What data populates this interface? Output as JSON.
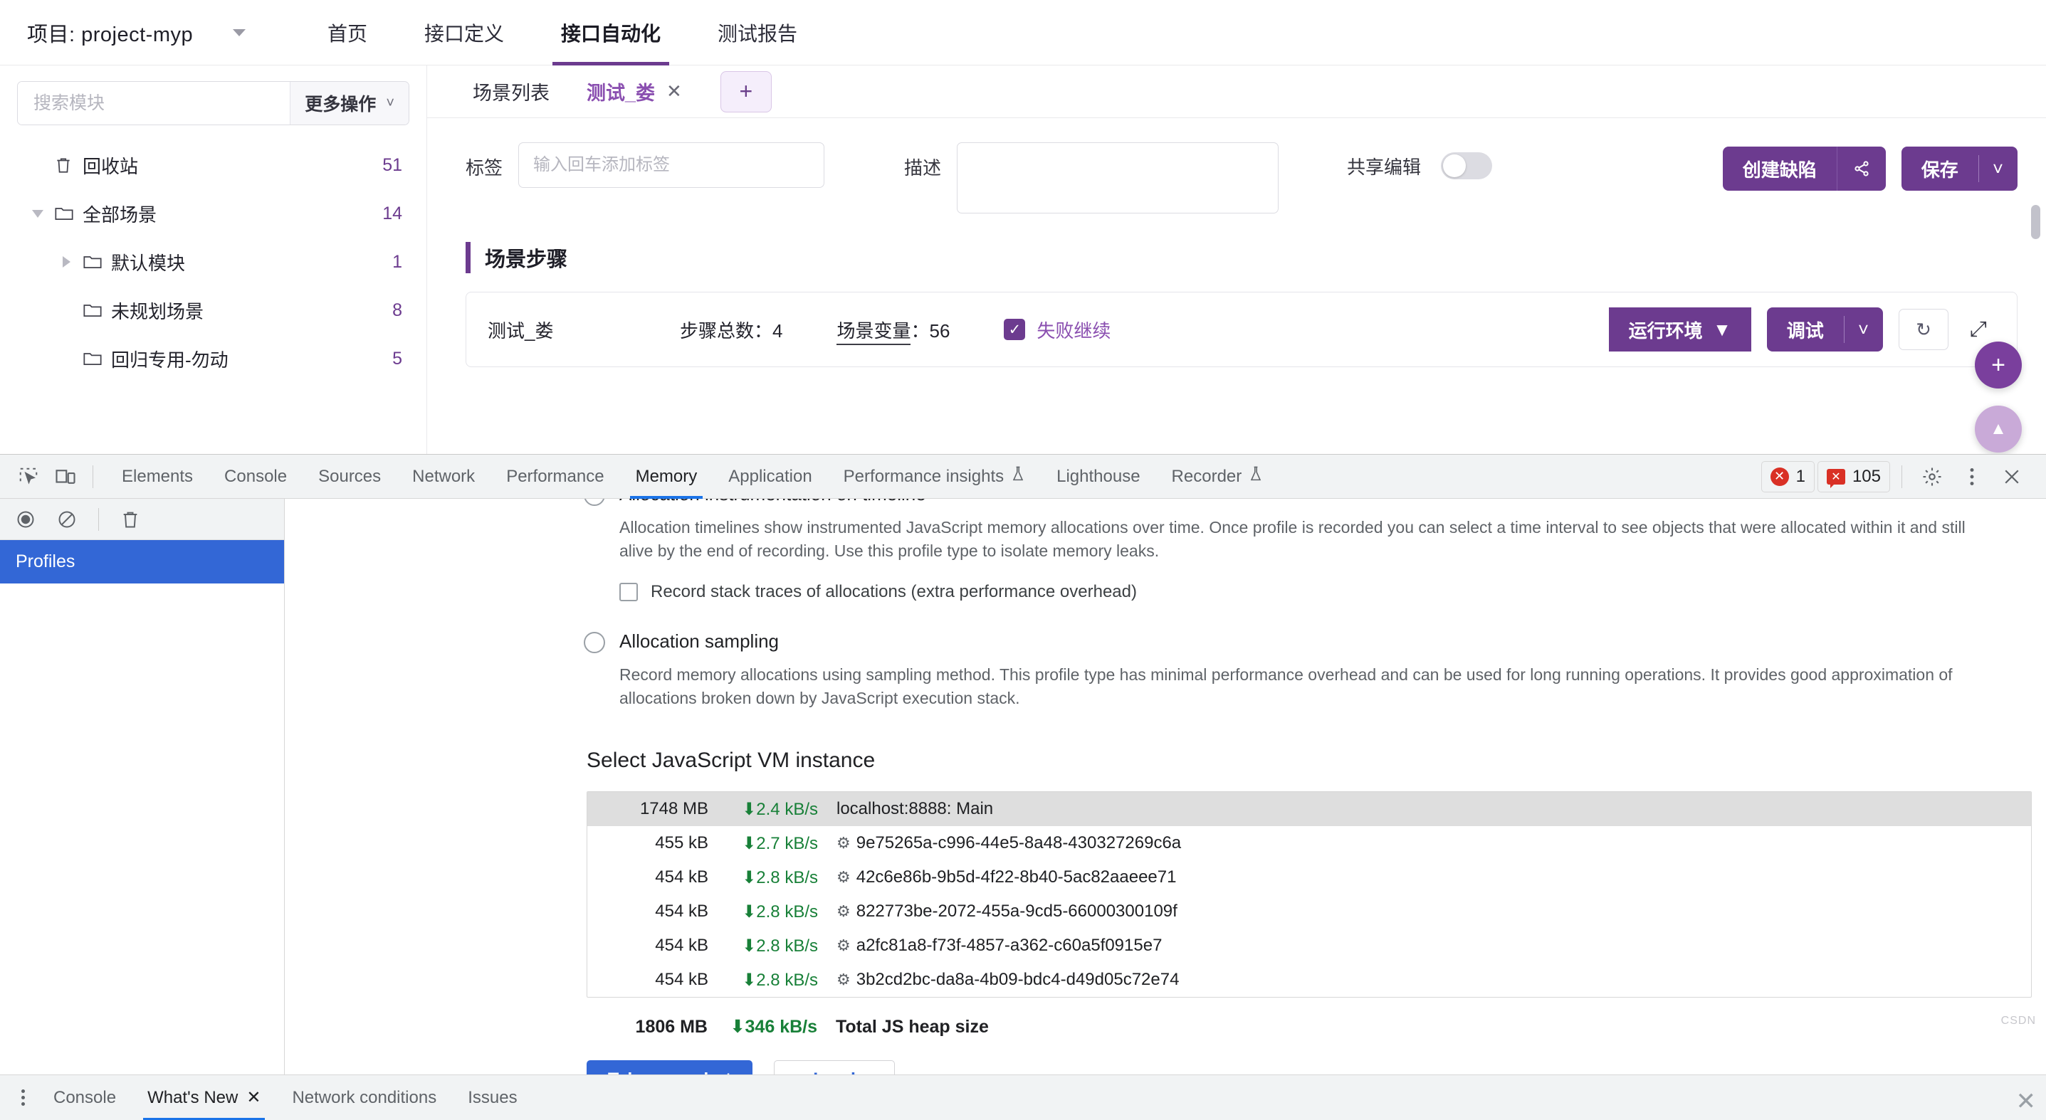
{
  "webapp": {
    "project": {
      "label": "项目: project-myp",
      "caret": "chevron-down-icon"
    },
    "nav_tabs": [
      {
        "label": "首页",
        "active": false
      },
      {
        "label": "接口定义",
        "active": false
      },
      {
        "label": "接口自动化",
        "active": true
      },
      {
        "label": "测试报告",
        "active": false
      }
    ],
    "sidebar": {
      "search_placeholder": "搜索模块",
      "search_value": "",
      "more_ops_label": "更多操作",
      "tree": [
        {
          "label": "回收站",
          "count": "51",
          "icon": "trash-icon",
          "level": 0,
          "arrow": "none"
        },
        {
          "label": "全部场景",
          "count": "14",
          "icon": "folder-icon",
          "level": 1,
          "arrow": "down"
        },
        {
          "label": "默认模块",
          "count": "1",
          "icon": "folder-icon",
          "level": 2,
          "arrow": "right"
        },
        {
          "label": "未规划场景",
          "count": "8",
          "icon": "folder-icon",
          "level": 2,
          "arrow": "none"
        },
        {
          "label": "回归专用-勿动",
          "count": "5",
          "icon": "folder-icon",
          "level": 2,
          "arrow": "none"
        }
      ]
    },
    "tabs": [
      {
        "label": "场景列表",
        "selected": false,
        "closable": false
      },
      {
        "label": "测试_娄",
        "selected": true,
        "closable": true
      }
    ],
    "tab_add_label": "+",
    "form": {
      "tag_label": "标签",
      "tag_placeholder": "输入回车添加标签",
      "tag_value": "",
      "desc_label": "描述",
      "desc_value": "",
      "shared_edit_label": "共享编辑",
      "shared_edit_on": false,
      "create_defect_label": "创建缺陷",
      "share_icon": "share-icon",
      "save_label": "保存",
      "save_caret": "chevron-down-icon"
    },
    "steps": {
      "section_title": "场景步骤",
      "name": "测试_娄",
      "total_label": "步骤总数：4",
      "variable_label": "场景变量",
      "variable_value": "56",
      "continue_on_fail_label": "失败继续",
      "continue_on_fail_checked": true,
      "env_label": "运行环境",
      "debug_label": "调试",
      "refresh_icon": "refresh-icon",
      "expand_icon": "expand-icon"
    },
    "fab_add": "+",
    "fab_up": "▲"
  },
  "devtools": {
    "toolbar": {
      "inspect_icon": "inspect-element-icon",
      "device_icon": "device-toolbar-icon",
      "tabs": [
        {
          "label": "Elements",
          "active": false,
          "beta": false
        },
        {
          "label": "Console",
          "active": false,
          "beta": false
        },
        {
          "label": "Sources",
          "active": false,
          "beta": false
        },
        {
          "label": "Network",
          "active": false,
          "beta": false
        },
        {
          "label": "Performance",
          "active": false,
          "beta": false
        },
        {
          "label": "Memory",
          "active": true,
          "beta": false
        },
        {
          "label": "Application",
          "active": false,
          "beta": false
        },
        {
          "label": "Performance insights",
          "active": false,
          "beta": true
        },
        {
          "label": "Lighthouse",
          "active": false,
          "beta": false
        },
        {
          "label": "Recorder",
          "active": false,
          "beta": true
        }
      ],
      "error_count": "1",
      "warning_count": "105",
      "settings_icon": "gear-icon",
      "more_icon": "more-vertical-icon",
      "close_icon": "close-icon"
    },
    "left_panel": {
      "record_icon": "record-icon",
      "clear_icon": "no-entry-icon",
      "delete_icon": "trash-icon",
      "profiles_label": "Profiles"
    },
    "memory": {
      "option_timeline": {
        "title": "Allocation instrumentation on timeline",
        "selected": false,
        "description": "Allocation timelines show instrumented JavaScript memory allocations over time. Once profile is recorded you can select a time interval to see objects that were allocated within it and still alive by the end of recording. Use this profile type to isolate memory leaks.",
        "checkbox_label": "Record stack traces of allocations (extra performance overhead)",
        "checkbox_checked": false
      },
      "option_sampling": {
        "title": "Allocation sampling",
        "selected": false,
        "description": "Record memory allocations using sampling method. This profile type has minimal performance overhead and can be used for long running operations. It provides good approximation of allocations broken down by JavaScript execution stack."
      },
      "vm_section_title": "Select JavaScript VM instance",
      "vm_rows": [
        {
          "size": "1748 MB",
          "rate": "2.4 kB/s",
          "name": "localhost:8888: Main",
          "selected": true,
          "has_gear": false
        },
        {
          "size": "455 kB",
          "rate": "2.7 kB/s",
          "name": "9e75265a-c996-44e5-8a48-430327269c6a",
          "selected": false,
          "has_gear": true
        },
        {
          "size": "454 kB",
          "rate": "2.8 kB/s",
          "name": "42c6e86b-9b5d-4f22-8b40-5ac82aaeee71",
          "selected": false,
          "has_gear": true
        },
        {
          "size": "454 kB",
          "rate": "2.8 kB/s",
          "name": "822773be-2072-455a-9cd5-66000300109f",
          "selected": false,
          "has_gear": true
        },
        {
          "size": "454 kB",
          "rate": "2.8 kB/s",
          "name": "a2fc81a8-f73f-4857-a362-c60a5f0915e7",
          "selected": false,
          "has_gear": true
        },
        {
          "size": "454 kB",
          "rate": "2.8 kB/s",
          "name": "3b2cd2bc-da8a-4b09-bdc4-d49d05c72e74",
          "selected": false,
          "has_gear": true
        }
      ],
      "total": {
        "size": "1806 MB",
        "rate": "346 kB/s",
        "label": "Total JS heap size"
      },
      "take_snapshot_label": "Take snapshot",
      "load_label": "Load"
    },
    "drawer": {
      "menu_icon": "more-vertical-icon",
      "tabs": [
        {
          "label": "Console",
          "active": false,
          "closable": false
        },
        {
          "label": "What's New",
          "active": true,
          "closable": true
        },
        {
          "label": "Network conditions",
          "active": false,
          "closable": false
        },
        {
          "label": "Issues",
          "active": false,
          "closable": false
        }
      ]
    },
    "watermark": "CSDN"
  },
  "colors": {
    "brand_purple": "#6c3b8f",
    "devtools_blue": "#1a73e8",
    "green": "#188038",
    "red": "#d93025"
  }
}
